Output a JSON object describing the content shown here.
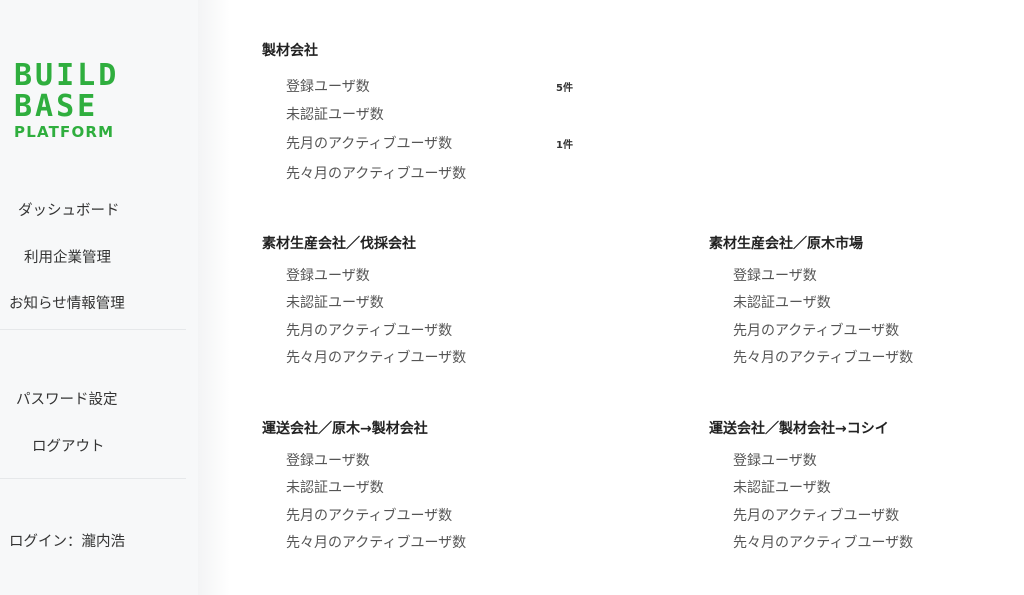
{
  "brand": {
    "line1": "BUILD",
    "line2": "BASE",
    "line3": "PLATFORM",
    "color": "#2fae3e"
  },
  "nav": {
    "items": [
      "ダッシュボード",
      "利用企業管理",
      "お知らせ情報管理"
    ],
    "account_items": [
      "パスワード設定",
      "ログアウト"
    ],
    "login_user": "ログイン：瀧内浩"
  },
  "stat_labels": [
    "登録ユーザ数",
    "未認証ユーザ数",
    "先月のアクティブユーザ数",
    "先々月のアクティブユーザ数"
  ],
  "sections": [
    {
      "title": "製材会社",
      "values": [
        "5件",
        "",
        "1件",
        ""
      ]
    },
    {
      "title": "素材生産会社／伐採会社",
      "values": [
        "",
        "",
        "",
        ""
      ]
    },
    {
      "title": "素材生産会社／原木市場",
      "values": [
        "",
        "",
        "",
        ""
      ]
    },
    {
      "title": "運送会社／原木→製材会社",
      "values": [
        "",
        "",
        "",
        ""
      ]
    },
    {
      "title": "運送会社／製材会社→コシイ",
      "values": [
        "",
        "",
        "",
        ""
      ]
    }
  ]
}
